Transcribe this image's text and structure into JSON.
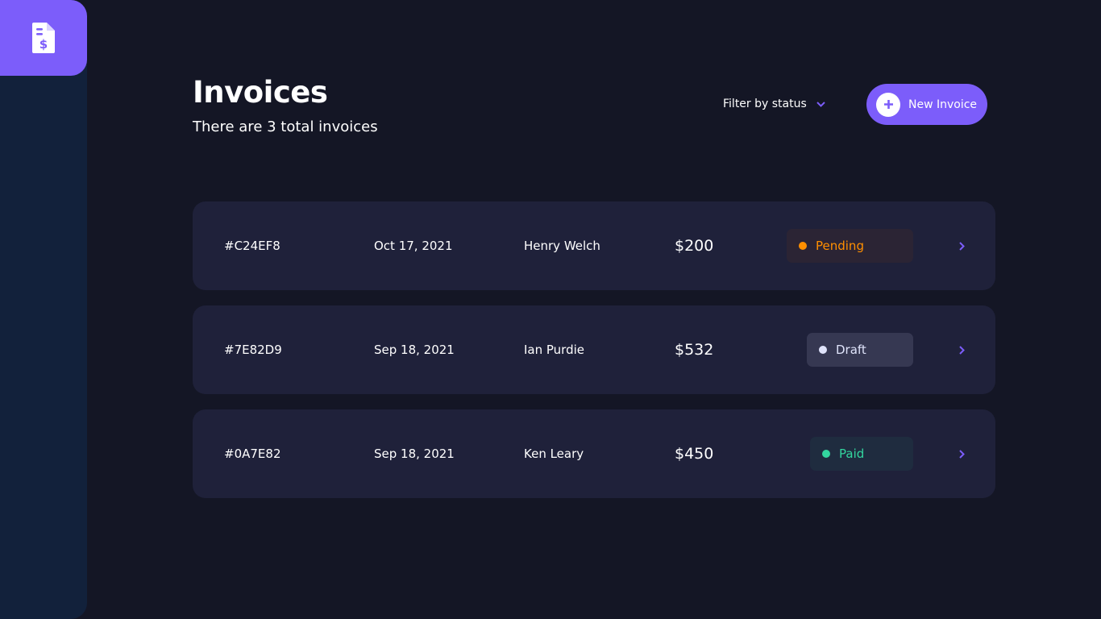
{
  "header": {
    "title": "Invoices",
    "subtitle": "There are 3 total invoices",
    "filter_label": "Filter by status",
    "new_invoice_label": "New Invoice"
  },
  "colors": {
    "accent": "#7c5dfa",
    "pending": "#ff8f00",
    "draft": "#dfe3fa",
    "paid": "#33d69f",
    "background": "#141625",
    "card": "#1f213a"
  },
  "icons": {
    "logo": "invoice-dollar-icon",
    "filter": "chevron-down-icon",
    "new": "plus-icon",
    "row": "chevron-right-icon"
  },
  "invoices": [
    {
      "id": "#C24EF8",
      "date": "Oct 17, 2021",
      "client": "Henry Welch",
      "amount": "$200",
      "status": "Pending"
    },
    {
      "id": "#7E82D9",
      "date": "Sep 18, 2021",
      "client": "Ian Purdie",
      "amount": "$532",
      "status": "Draft"
    },
    {
      "id": "#0A7E82",
      "date": "Sep 18, 2021",
      "client": "Ken Leary",
      "amount": "$450",
      "status": "Paid"
    }
  ]
}
